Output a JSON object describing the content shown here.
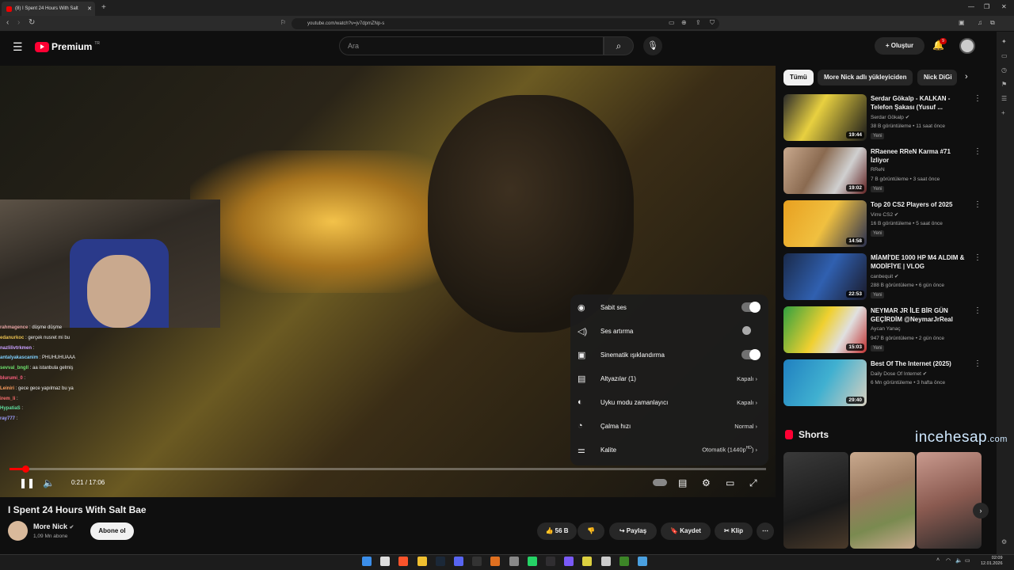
{
  "browser": {
    "tab_title": "(8) I Spent 24 Hours With Salt",
    "url": "youtube.com/watch?v=jv7dpmZNp-s"
  },
  "header": {
    "logo_text": "Premium",
    "logo_sup": "TR",
    "search_placeholder": "Ara",
    "create_label": "Oluştur",
    "notif_count": "9"
  },
  "chat": [
    {
      "user": "rahmagence",
      "msg": ": düşme düşme",
      "color": "#e0a0a0"
    },
    {
      "user": "edanurkoc",
      "msg": ": gerçek nusret mi bu",
      "color": "#e8c050"
    },
    {
      "user": "nazlilivtrkmen",
      "msg": ":",
      "color": "#c9a0ff"
    },
    {
      "user": "antalyakascanim",
      "msg": ": PHUHUHUAAA",
      "color": "#7fd0ff"
    },
    {
      "user": "sevval_bngll",
      "msg": ": aa istanbula gelmiş",
      "color": "#6ee06e"
    },
    {
      "user": "blurumi_0",
      "msg": ":",
      "color": "#ff6080"
    },
    {
      "user": "Leiniri",
      "msg": ": gece gece yapılmaz bu ya",
      "color": "#ffa060"
    },
    {
      "user": "irem_li",
      "msg": ":",
      "color": "#ff7070"
    },
    {
      "user": "HypatiaS",
      "msg": ":",
      "color": "#60e0a0"
    },
    {
      "user": "ray777",
      "msg": ":",
      "color": "#a0a0ff"
    }
  ],
  "settings": [
    {
      "label": "Sabit ses",
      "value": "",
      "toggle": "on",
      "icon": "stable-volume-icon"
    },
    {
      "label": "Ses artırma",
      "value": "",
      "toggle": "off",
      "icon": "volume-boost-icon"
    },
    {
      "label": "Sinematik ışıklandırma",
      "value": "",
      "toggle": "on",
      "icon": "ambient-mode-icon"
    },
    {
      "label": "Altyazılar (1)",
      "value": "Kapalı",
      "toggle": "",
      "icon": "subtitles-icon"
    },
    {
      "label": "Uyku modu zamanlayıcı",
      "value": "Kapalı",
      "toggle": "",
      "icon": "sleep-timer-icon"
    },
    {
      "label": "Çalma hızı",
      "value": "Normal",
      "toggle": "",
      "icon": "playback-speed-icon"
    },
    {
      "label": "Kalite",
      "value": "Otomatik (1440p",
      "value_sup": "HD",
      "toggle": "",
      "icon": "quality-icon"
    }
  ],
  "player": {
    "time": "0:21 / 17:06",
    "progress": 0.0205
  },
  "video": {
    "title": "I Spent 24 Hours With Salt Bae",
    "channel": "More Nick",
    "subscribers": "1,09 Mn abone",
    "subscribe_label": "Abone ol",
    "likes": "56 B",
    "share_label": "Paylaş",
    "save_label": "Kaydet",
    "clip_label": "Klip"
  },
  "chips": [
    "Tümü",
    "More Nick adlı yükleyiciden",
    "Nick DiGi"
  ],
  "recommendations": [
    {
      "title": "Serdar Gökalp - KALKAN - Telefon Şakası (Yusuf ...",
      "channel": "Serdar Gökalp",
      "verified": true,
      "meta": "38 B görüntüleme • 11 saat önce",
      "badge": "Yeni",
      "duration": "19:44",
      "thumb": "linear-gradient(120deg,#2a2a2a,#e8d040 40%,#1a1a1a)"
    },
    {
      "title": "RRaenee RReN Karma #71 İzliyor",
      "channel": "RReN",
      "verified": false,
      "meta": "7 B görüntüleme • 3 saat önce",
      "badge": "Yeni",
      "duration": "19:02",
      "thumb": "linear-gradient(120deg,#c9a98e,#8a6a50 40%,#d0d0d0 70%,#602020)"
    },
    {
      "title": "Top 20 CS2 Players of 2025",
      "channel": "Virre CS2",
      "verified": true,
      "meta": "16 B görüntüleme • 5 saat önce",
      "badge": "Yeni",
      "duration": "14:58",
      "thumb": "linear-gradient(120deg,#e8a020,#f0c040 50%,#2a3050)"
    },
    {
      "title": "MİAMİ'DE 1000 HP M4 ALDIM & MODİFİYE | VLOG",
      "channel": "canbequit",
      "verified": true,
      "meta": "288 B görüntüleme • 6 gün önce",
      "badge": "Yeni",
      "duration": "22:53",
      "thumb": "linear-gradient(120deg,#1a2a4a,#3060b0 50%,#1a1a2a)"
    },
    {
      "title": "NEYMAR JR İLE BİR GÜN GEÇİRDİM @NeymarJrReal",
      "channel": "Aycan Yanaç",
      "verified": false,
      "meta": "947 B görüntüleme • 2 gün önce",
      "badge": "Yeni",
      "duration": "15:03",
      "thumb": "linear-gradient(120deg,#30a040,#f0d030 45%,#e0e0e0 70%,#c03030)"
    },
    {
      "title": "Best Of The Internet (2025)",
      "channel": "Daily Dose Of Internet",
      "verified": true,
      "meta": "6 Mn görüntüleme • 3 hafta önce",
      "badge": "",
      "duration": "29:40",
      "thumb": "linear-gradient(120deg,#2080c0,#40b0d0 50%,#d8d0c0)"
    }
  ],
  "shorts": {
    "label": "Shorts",
    "watermark": "incehesap",
    "watermark_suffix": ".com"
  },
  "clock": {
    "time": "02:09",
    "date": "12.01.2026"
  }
}
